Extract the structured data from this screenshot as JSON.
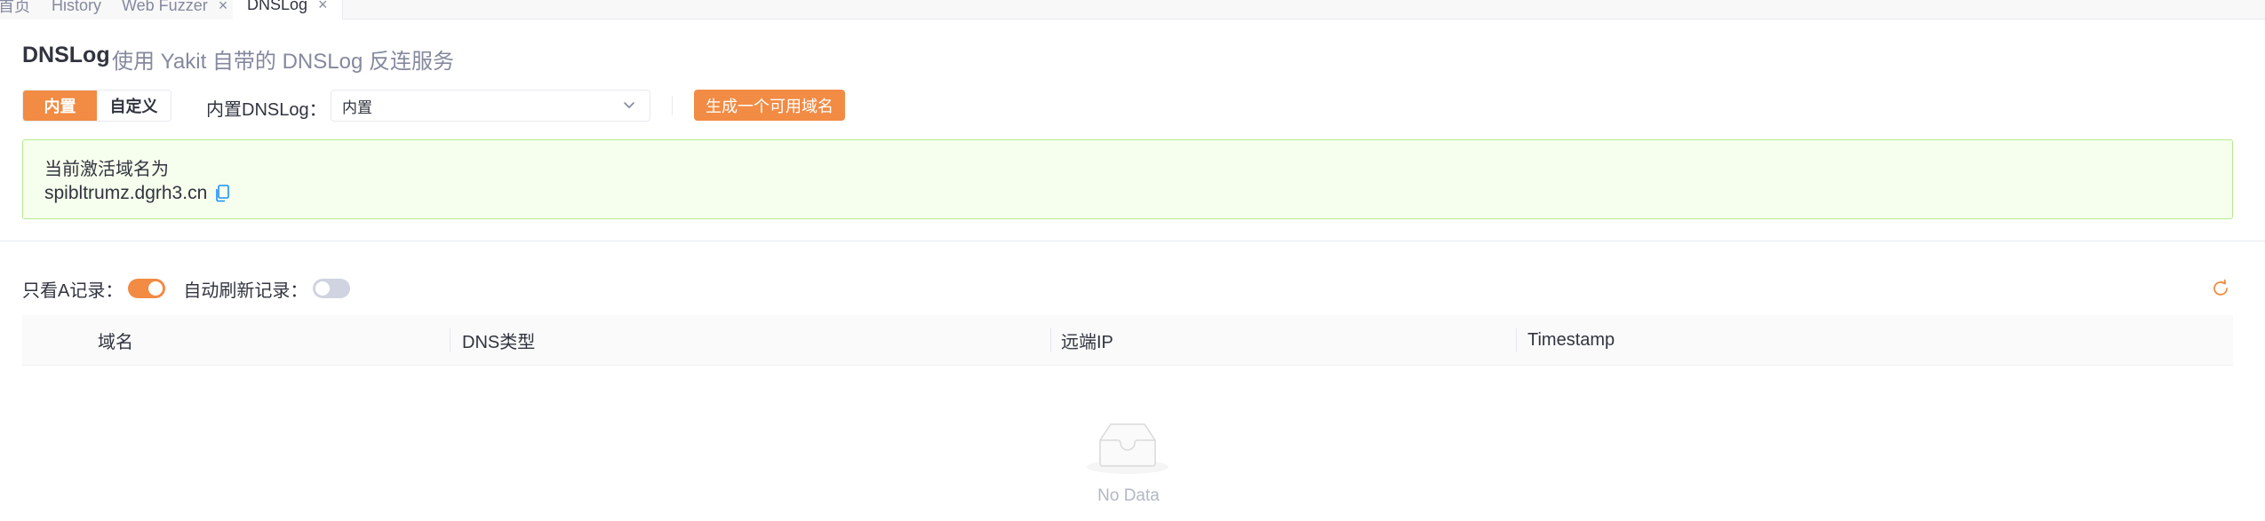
{
  "tabs": [
    {
      "label": "首页",
      "closable": false,
      "active": false
    },
    {
      "label": "History",
      "closable": false,
      "active": false
    },
    {
      "label": "Web Fuzzer",
      "closable": true,
      "active": false
    },
    {
      "label": "DNSLog",
      "closable": true,
      "active": true
    }
  ],
  "tab_close_glyph": "×",
  "header": {
    "title": "DNSLog",
    "subtitle": "使用 Yakit 自带的 DNSLog 反连服务"
  },
  "mode": {
    "options": [
      "内置",
      "自定义"
    ],
    "selected": "内置"
  },
  "builtin_select": {
    "label": "内置DNSLog：",
    "value": "内置"
  },
  "generate_button": "生成一个可用域名",
  "active_domain": {
    "label": "当前激活域名为",
    "value": "spibltrumz.dgrh3.cn"
  },
  "filters": {
    "only_a_records_label": "只看A记录：",
    "only_a_records": true,
    "auto_refresh_label": "自动刷新记录：",
    "auto_refresh": false
  },
  "table": {
    "columns": [
      "域名",
      "DNS类型",
      "远端IP",
      "Timestamp"
    ],
    "rows": [],
    "empty_text": "No Data"
  },
  "colors": {
    "accent": "#f28b44",
    "success_bg": "#f6ffed",
    "success_border": "#b7eb8f",
    "link_blue": "#1890ff"
  },
  "icons": {
    "copy": "copy-icon",
    "refresh": "refresh-icon",
    "chevron": "chevron-down-icon",
    "empty": "empty-inbox-icon"
  }
}
